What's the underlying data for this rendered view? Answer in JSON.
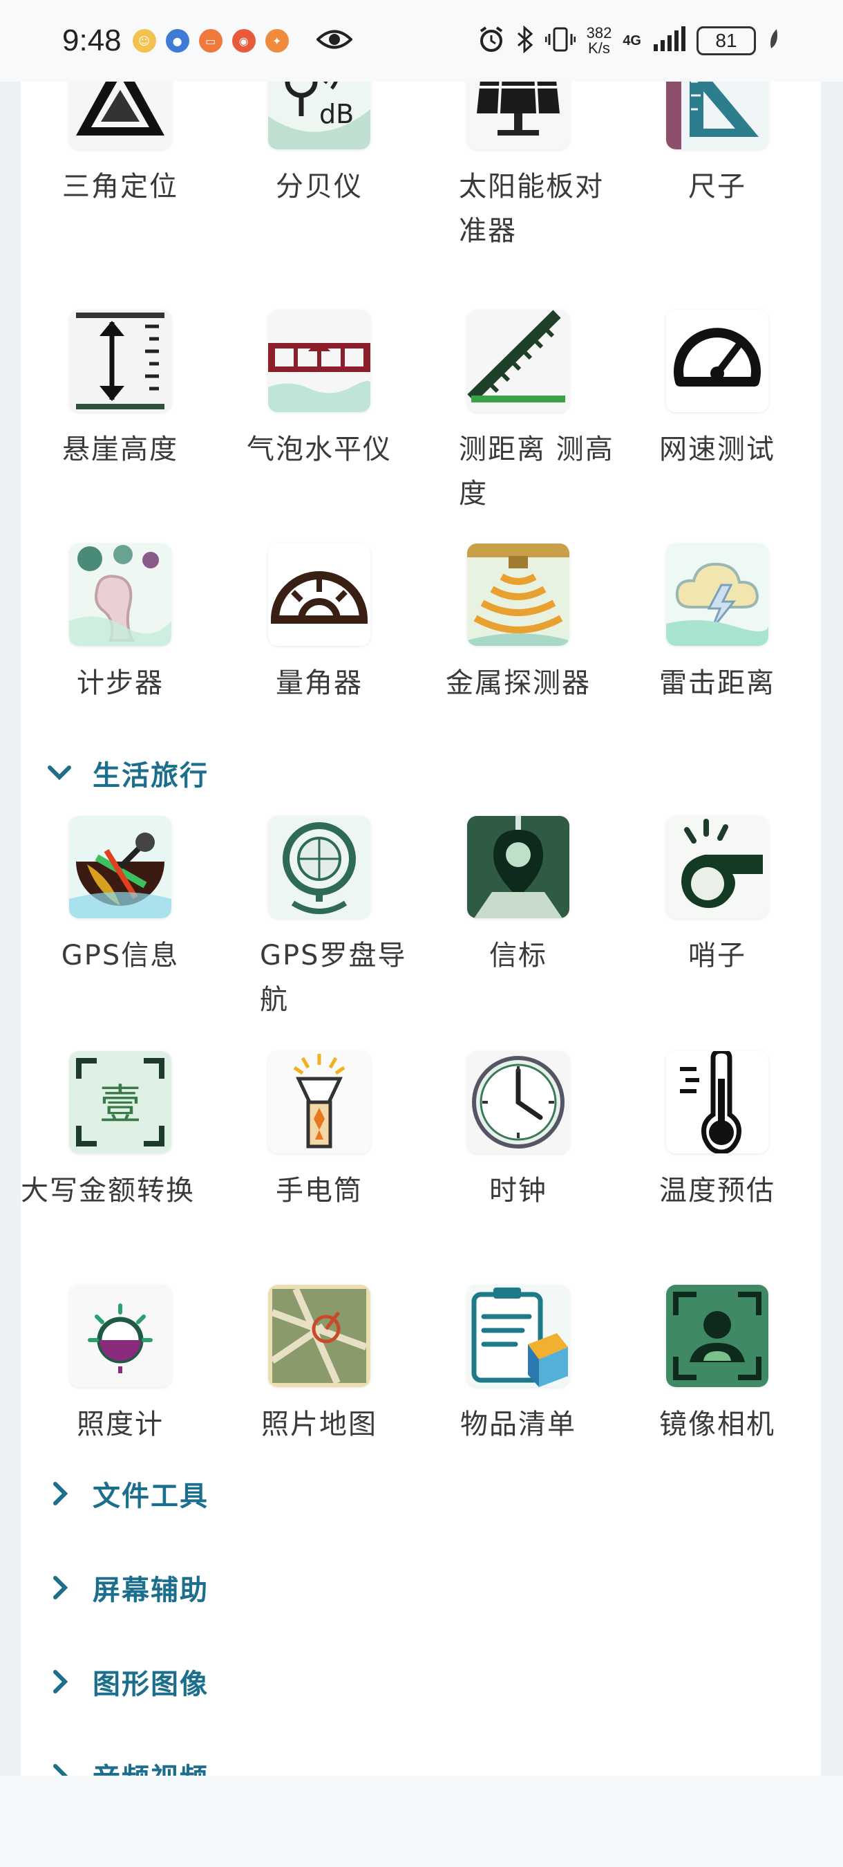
{
  "status": {
    "time": "9:48",
    "speed_value": "382",
    "speed_unit": "K/s",
    "network": "4G",
    "battery": "81"
  },
  "tools_top": [
    {
      "label": "三角定位",
      "icon": "triangle-icon"
    },
    {
      "label": "分贝仪",
      "icon": "decibel-icon"
    },
    {
      "label": "太阳能板对准器",
      "icon": "solar-panel-icon"
    },
    {
      "label": "尺子",
      "icon": "ruler-icon"
    },
    {
      "label": "悬崖高度",
      "icon": "height-icon"
    },
    {
      "label": "气泡水平仪",
      "icon": "level-icon"
    },
    {
      "label": "测距离 测高度",
      "icon": "measure-icon"
    },
    {
      "label": "网速测试",
      "icon": "speedometer-icon"
    },
    {
      "label": "计步器",
      "icon": "footprint-icon"
    },
    {
      "label": "量角器",
      "icon": "protractor-icon"
    },
    {
      "label": "金属探测器",
      "icon": "metal-detector-icon"
    },
    {
      "label": "雷击距离",
      "icon": "lightning-icon"
    }
  ],
  "sections": {
    "life_travel": "生活旅行",
    "file_tools": "文件工具",
    "screen_assist": "屏幕辅助",
    "graphics": "图形图像",
    "audio_video": "音频视频"
  },
  "tools_life": [
    {
      "label": "GPS信息",
      "icon": "gps-info-icon"
    },
    {
      "label": "GPS罗盘导航",
      "icon": "compass-icon"
    },
    {
      "label": "信标",
      "icon": "beacon-icon"
    },
    {
      "label": "哨子",
      "icon": "whistle-icon"
    },
    {
      "label": "大写金额转换",
      "icon": "currency-icon"
    },
    {
      "label": "手电筒",
      "icon": "flashlight-icon"
    },
    {
      "label": "时钟",
      "icon": "clock-icon"
    },
    {
      "label": "温度预估",
      "icon": "thermometer-icon"
    },
    {
      "label": "照度计",
      "icon": "lux-meter-icon"
    },
    {
      "label": "照片地图",
      "icon": "photo-map-icon"
    },
    {
      "label": "物品清单",
      "icon": "checklist-icon"
    },
    {
      "label": "镜像相机",
      "icon": "mirror-camera-icon"
    }
  ],
  "colors": {
    "accent": "#1b6f8d",
    "chevron": "#1f6f8b",
    "label": "#3a3a3a"
  }
}
